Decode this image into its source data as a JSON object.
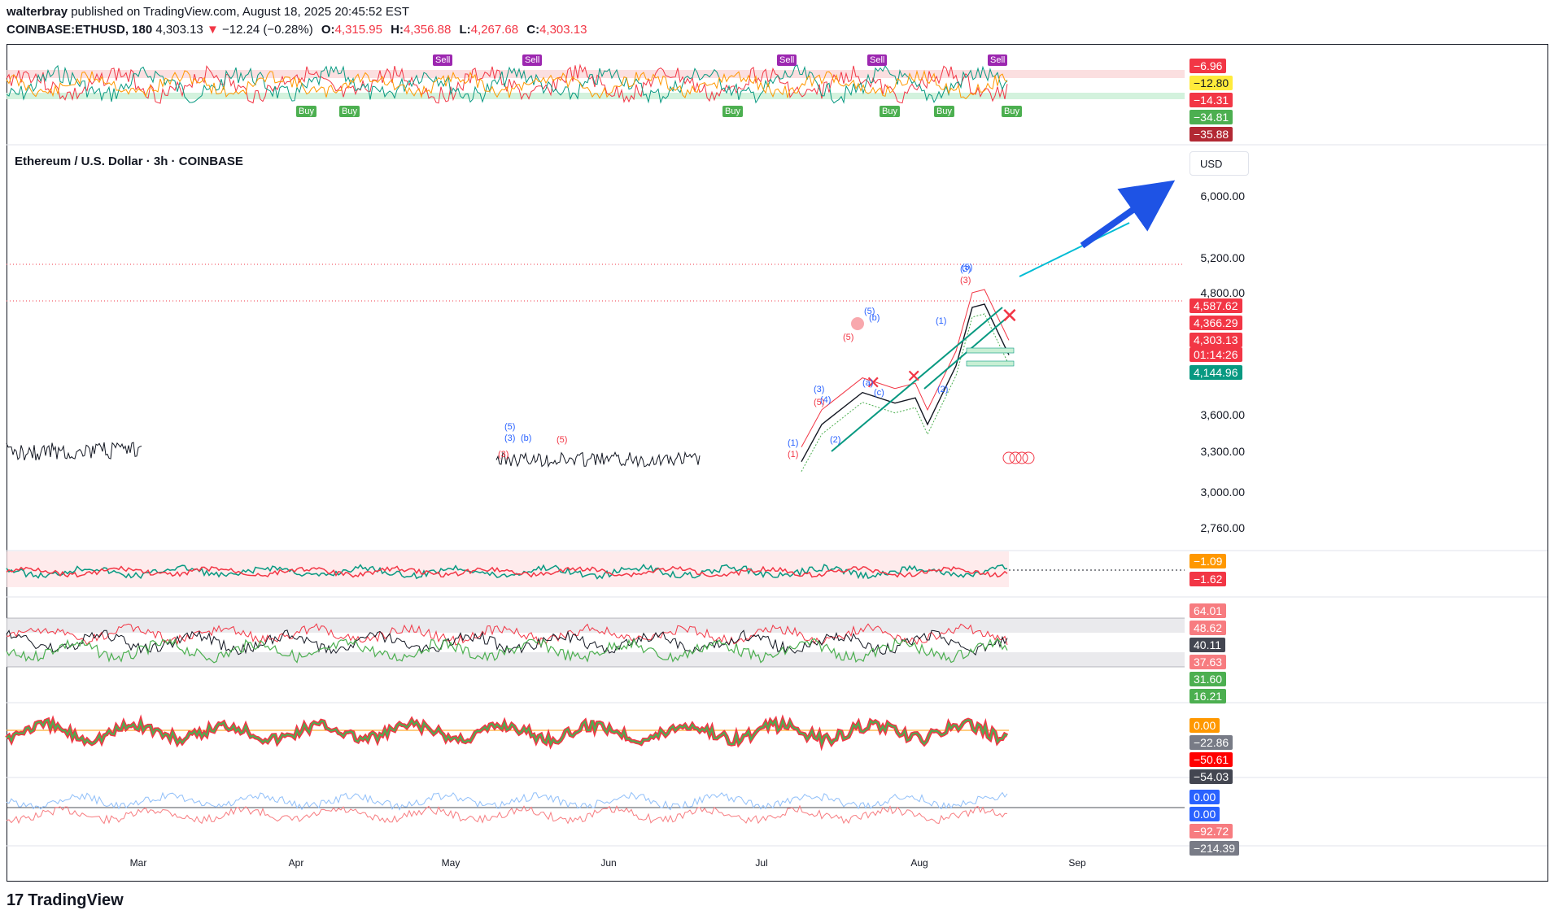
{
  "header": {
    "author": "walterbray",
    "published_text": "published on TradingView.com, August 18, 2025 20:45:52 EST",
    "symbol": "COINBASE:ETHUSD, 180",
    "last": "4,303.13",
    "change_arrow": "▼",
    "change": "−12.24 (−0.28%)",
    "o_label": "O:",
    "o": "4,315.95",
    "h_label": "H:",
    "h": "4,356.88",
    "l_label": "L:",
    "l": "4,267.68",
    "c_label": "C:",
    "c": "4,303.13"
  },
  "chart_title": "Ethereum / U.S. Dollar · 3h · COINBASE",
  "currency": "USD",
  "footer": {
    "brand": "TradingView"
  },
  "price_axis": [
    "6,000.00",
    "5,200.00",
    "4,800.00",
    "3,600.00",
    "3,300.00",
    "3,000.00",
    "2,760.00"
  ],
  "price_tags": [
    {
      "text": "4,587.62",
      "color": "#f23645"
    },
    {
      "text": "4,366.29",
      "color": "#f23645"
    },
    {
      "text": "4,303.13",
      "color": "#f23645"
    },
    {
      "text": "01:14:26",
      "color": "#f23645"
    },
    {
      "text": "4,144.96",
      "color": "#089981"
    }
  ],
  "pane1_tags": [
    {
      "text": "−6.96",
      "color": "#f23645",
      "fg": "#ffffff"
    },
    {
      "text": "−12.80",
      "color": "#ffeb3b",
      "fg": "#131722"
    },
    {
      "text": "−14.31",
      "color": "#f23645",
      "fg": "#ffffff"
    },
    {
      "text": "−34.81",
      "color": "#4caf50",
      "fg": "#ffffff"
    },
    {
      "text": "−35.88",
      "color": "#b22833",
      "fg": "#ffffff"
    }
  ],
  "pane3_tags": [
    {
      "text": "−1.09",
      "color": "#ff9800"
    },
    {
      "text": "−1.62",
      "color": "#f23645"
    }
  ],
  "pane4_tags": [
    {
      "text": "64.01",
      "color": "#f77c80"
    },
    {
      "text": "48.62",
      "color": "#f77c80"
    },
    {
      "text": "40.11",
      "color": "#434651"
    },
    {
      "text": "37.63",
      "color": "#f77c80"
    },
    {
      "text": "31.60",
      "color": "#4caf50"
    },
    {
      "text": "16.21",
      "color": "#4caf50"
    }
  ],
  "pane5_tags": [
    {
      "text": "0.00",
      "color": "#ff9800"
    },
    {
      "text": "−22.86",
      "color": "#787b86"
    },
    {
      "text": "−50.61",
      "color": "#ff0000"
    },
    {
      "text": "−54.03",
      "color": "#434651"
    }
  ],
  "pane6_tags": [
    {
      "text": "0.00",
      "color": "#2962ff"
    },
    {
      "text": "0.00",
      "color": "#2962ff"
    },
    {
      "text": "−92.72",
      "color": "#f77c80"
    },
    {
      "text": "−214.39",
      "color": "#787b86"
    }
  ],
  "signals": {
    "sell_label": "Sell",
    "buy_label": "Buy"
  },
  "wave_labels": [
    "(1)",
    "(2)",
    "(3)",
    "(4)",
    "(5)",
    "(a)",
    "(b)",
    "(c)"
  ],
  "chart_data": {
    "type": "line",
    "title": "Ethereum / U.S. Dollar · 3h · COINBASE",
    "x": [
      "Mar",
      "Apr",
      "May",
      "Jun",
      "Jul",
      "Aug",
      "Sep"
    ],
    "xlabel": "",
    "ylabel": "",
    "y_axis_ticks": [
      2760,
      3000,
      3300,
      3600,
      4800,
      5200,
      6000
    ],
    "series": [
      {
        "values": [
          {
            "x": "Jul",
            "y": 3300
          },
          {
            "x": "Jul",
            "y": 3650
          },
          {
            "x": "Jul",
            "y": 3950
          },
          {
            "x": "Jul",
            "y": 3850
          },
          {
            "x": "Aug",
            "y": 3900
          },
          {
            "x": "Aug",
            "y": 3650
          },
          {
            "x": "Aug",
            "y": 4200
          },
          {
            "x": "Aug",
            "y": 4750
          },
          {
            "x": "Aug",
            "y": 4780
          },
          {
            "x": "Aug",
            "y": 4303.13
          }
        ]
      }
    ],
    "levels": [
      4587.62,
      4366.29,
      4303.13,
      4144.96
    ],
    "grid": true
  }
}
